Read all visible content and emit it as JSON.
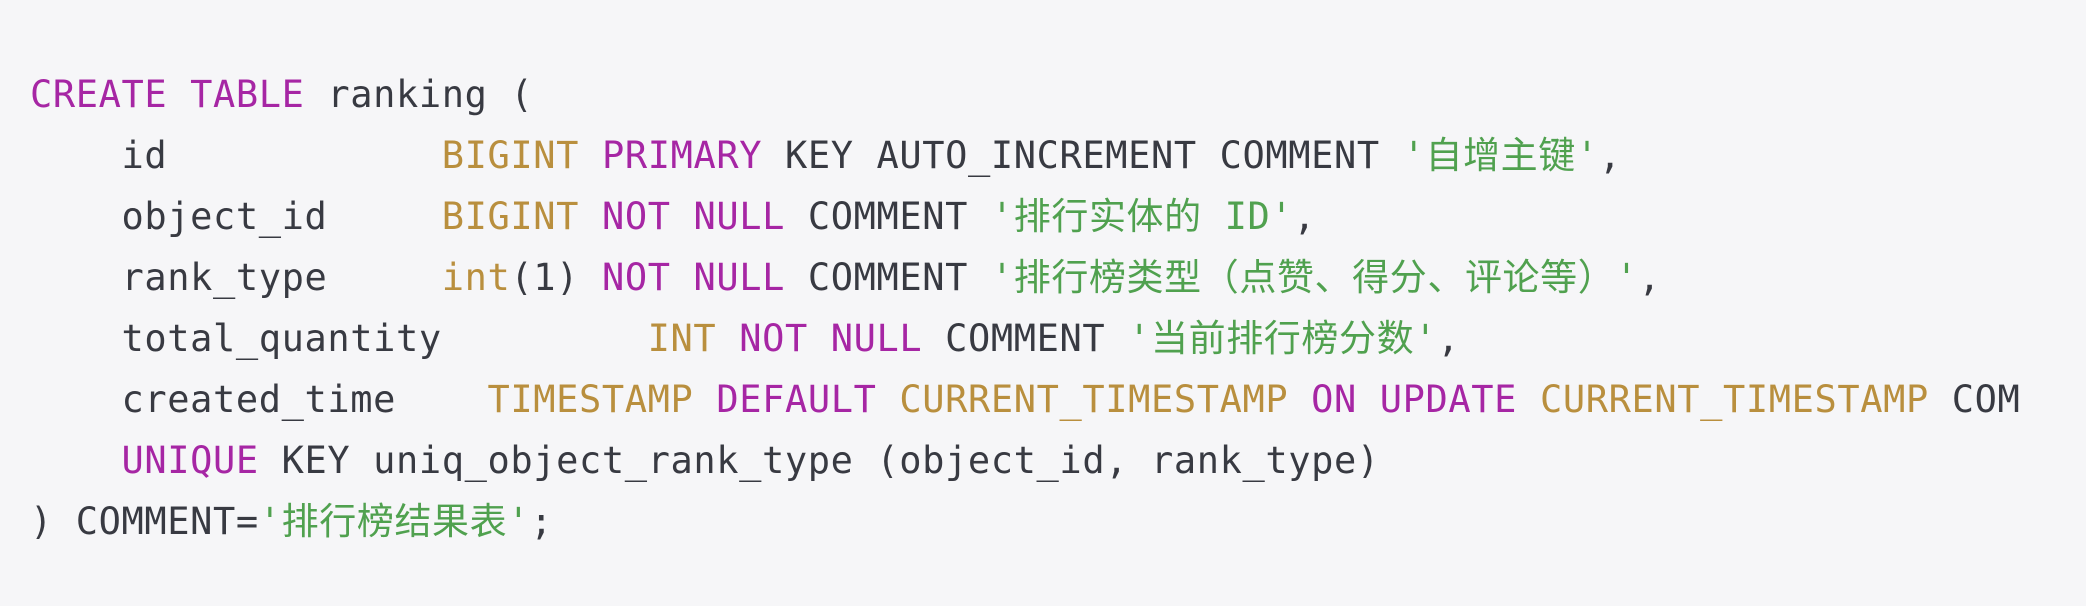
{
  "code": {
    "language": "sql",
    "lines": [
      [
        {
          "t": "CREATE",
          "c": "kw"
        },
        {
          "t": " ",
          "c": "plain"
        },
        {
          "t": "TABLE",
          "c": "kw"
        },
        {
          "t": " ranking (",
          "c": "plain"
        }
      ],
      [
        {
          "t": "    id            ",
          "c": "plain"
        },
        {
          "t": "BIGINT",
          "c": "type"
        },
        {
          "t": " ",
          "c": "plain"
        },
        {
          "t": "PRIMARY",
          "c": "kw"
        },
        {
          "t": " KEY AUTO_INCREMENT COMMENT ",
          "c": "plain"
        },
        {
          "t": "'自增主键'",
          "c": "str"
        },
        {
          "t": ",",
          "c": "plain"
        }
      ],
      [
        {
          "t": "    object_id     ",
          "c": "plain"
        },
        {
          "t": "BIGINT",
          "c": "type"
        },
        {
          "t": " ",
          "c": "plain"
        },
        {
          "t": "NOT",
          "c": "kw"
        },
        {
          "t": " ",
          "c": "plain"
        },
        {
          "t": "NULL",
          "c": "kw"
        },
        {
          "t": " COMMENT ",
          "c": "plain"
        },
        {
          "t": "'排行实体的 ID'",
          "c": "str"
        },
        {
          "t": ",",
          "c": "plain"
        }
      ],
      [
        {
          "t": "    rank_type     ",
          "c": "plain"
        },
        {
          "t": "int",
          "c": "type"
        },
        {
          "t": "(1) ",
          "c": "plain"
        },
        {
          "t": "NOT",
          "c": "kw"
        },
        {
          "t": " ",
          "c": "plain"
        },
        {
          "t": "NULL",
          "c": "kw"
        },
        {
          "t": " COMMENT ",
          "c": "plain"
        },
        {
          "t": "'排行榜类型（点赞、得分、评论等）'",
          "c": "str"
        },
        {
          "t": ",",
          "c": "plain"
        }
      ],
      [
        {
          "t": "    total_quantity         ",
          "c": "plain"
        },
        {
          "t": "INT",
          "c": "type"
        },
        {
          "t": " ",
          "c": "plain"
        },
        {
          "t": "NOT",
          "c": "kw"
        },
        {
          "t": " ",
          "c": "plain"
        },
        {
          "t": "NULL",
          "c": "kw"
        },
        {
          "t": " COMMENT ",
          "c": "plain"
        },
        {
          "t": "'当前排行榜分数'",
          "c": "str"
        },
        {
          "t": ",",
          "c": "plain"
        }
      ],
      [
        {
          "t": "    created_time    ",
          "c": "plain"
        },
        {
          "t": "TIMESTAMP",
          "c": "type"
        },
        {
          "t": " ",
          "c": "plain"
        },
        {
          "t": "DEFAULT",
          "c": "kw"
        },
        {
          "t": " ",
          "c": "plain"
        },
        {
          "t": "CURRENT_TIMESTAMP",
          "c": "type"
        },
        {
          "t": " ",
          "c": "plain"
        },
        {
          "t": "ON",
          "c": "kw"
        },
        {
          "t": " ",
          "c": "plain"
        },
        {
          "t": "UPDATE",
          "c": "kw"
        },
        {
          "t": " ",
          "c": "plain"
        },
        {
          "t": "CURRENT_TIMESTAMP",
          "c": "type"
        },
        {
          "t": " COM",
          "c": "plain"
        }
      ],
      [
        {
          "t": "    ",
          "c": "plain"
        },
        {
          "t": "UNIQUE",
          "c": "kw"
        },
        {
          "t": " KEY uniq_object_rank_type (object_id, rank_type)",
          "c": "plain"
        }
      ],
      [
        {
          "t": ") COMMENT=",
          "c": "plain"
        },
        {
          "t": "'排行榜结果表'",
          "c": "str"
        },
        {
          "t": ";",
          "c": "plain"
        }
      ]
    ]
  }
}
